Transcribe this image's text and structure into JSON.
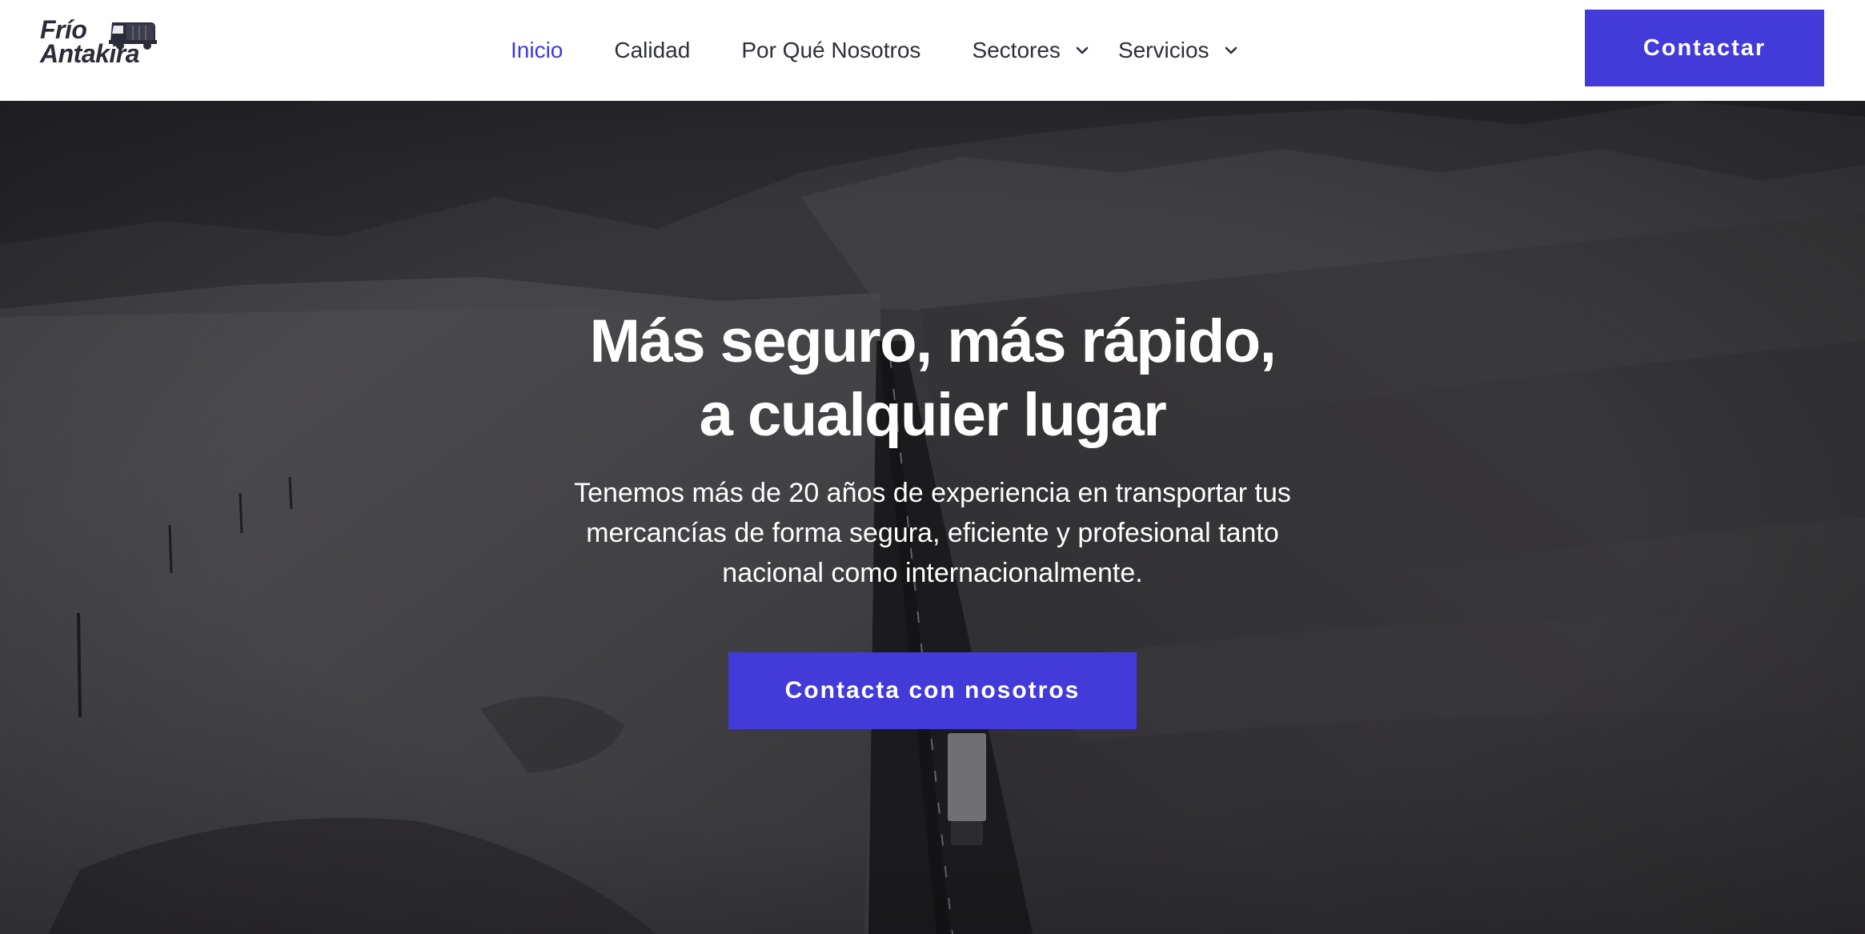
{
  "logo": {
    "line1": "Frío",
    "line2": "Antakira",
    "icon": "truck-icon"
  },
  "nav": {
    "items": [
      {
        "label": "Inicio",
        "active": true
      },
      {
        "label": "Calidad"
      },
      {
        "label": "Por Qué Nosotros"
      },
      {
        "label": "Sectores",
        "dropdown": true
      },
      {
        "label": "Servicios",
        "dropdown": true
      }
    ],
    "contact_label": "Contactar"
  },
  "hero": {
    "title_line1": "Más seguro, más rápido,",
    "title_line2": "a cualquier lugar",
    "subtitle_line1": "Tenemos más de 20 años de experiencia en transportar tus",
    "subtitle_line2": "mercancías de forma segura, eficiente y profesional tanto",
    "subtitle_line3": "nacional como internacionalmente.",
    "cta_label": "Contacta con nosotros",
    "background": "snowy-mountain-road-photo"
  },
  "colors": {
    "accent": "#433bd9",
    "active_nav": "#3f3ad8",
    "text_dark": "#2d2f3a"
  }
}
